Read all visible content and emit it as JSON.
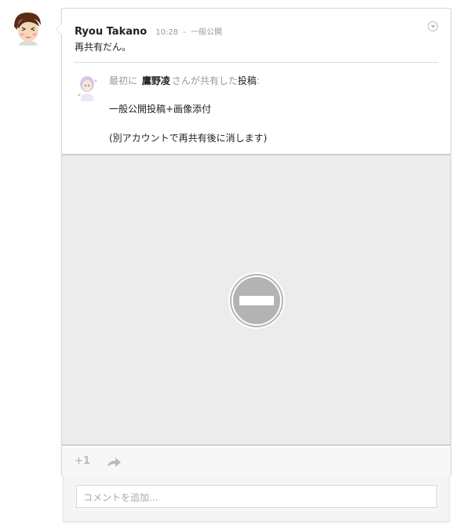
{
  "post": {
    "author": "Ryou Takano",
    "time": "10:28",
    "separator": "-",
    "visibility": "一般公開",
    "text": "再共有だん。"
  },
  "reshare": {
    "prefix": "最初に",
    "original_author": "鷹野凌",
    "middle": "さんが共有した",
    "post_word": "投稿",
    "colon": ":",
    "body_line1": "一般公開投稿+画像添付",
    "body_line2": "(別アカウントで再共有後に消します)"
  },
  "actions": {
    "plusone_label": "+1"
  },
  "comment": {
    "placeholder": "コメントを追加..."
  },
  "colors": {
    "image_bg": "#ececec",
    "blocked_icon": "#b3b3b3"
  },
  "icons": {
    "avatar": "avatar-icon",
    "menu": "chevron-down-icon",
    "blocked": "blocked-image-icon",
    "share": "share-arrow-icon"
  }
}
